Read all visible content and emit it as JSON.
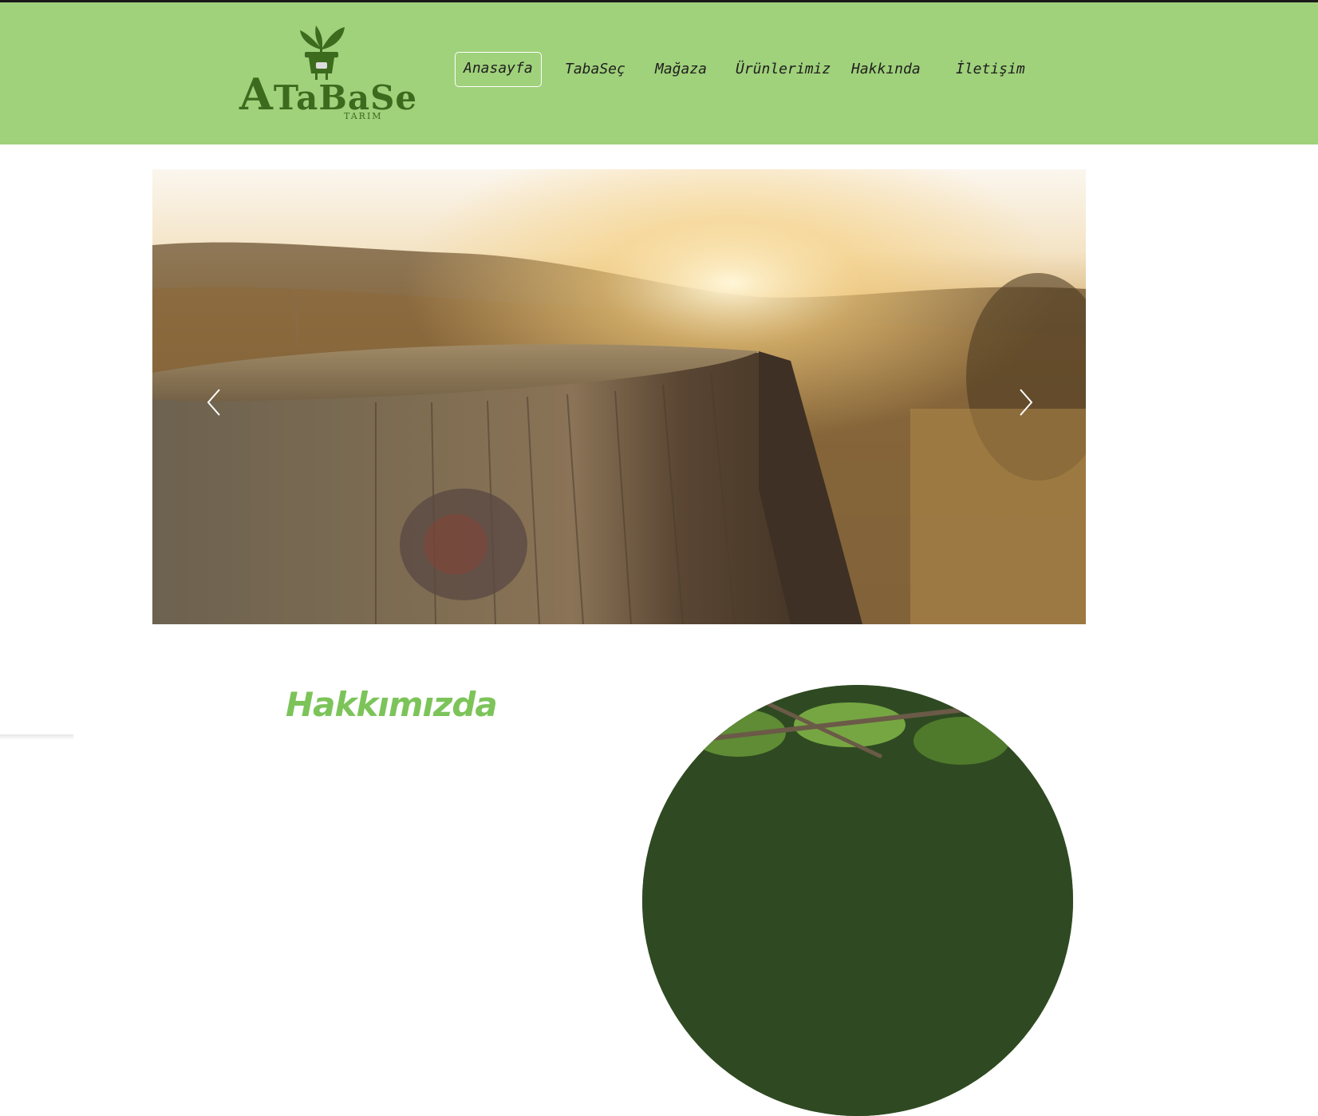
{
  "brand": {
    "logo_main": "ATaBaSe",
    "logo_initial": "A",
    "logo_rest": "TaBaSe",
    "logo_sub": "TARIM",
    "logo_icon": "plant-pot-icon",
    "color": "#3c6b1e"
  },
  "nav": {
    "items": [
      {
        "label": "Anasayfa",
        "active": true
      },
      {
        "label": "TabaSeç",
        "active": false
      },
      {
        "label": "Mağaza",
        "active": false
      },
      {
        "label": "Ürünlerimiz",
        "active": false
      },
      {
        "label": "Hakkında",
        "active": false
      },
      {
        "label": "İletişim",
        "active": false
      }
    ]
  },
  "carousel": {
    "prev_icon": "chevron-left-icon",
    "next_icon": "chevron-right-icon"
  },
  "about": {
    "title": "Hakkımızda"
  },
  "colors": {
    "header_bg": "#a0d17b",
    "accent_green": "#7cc45a"
  }
}
